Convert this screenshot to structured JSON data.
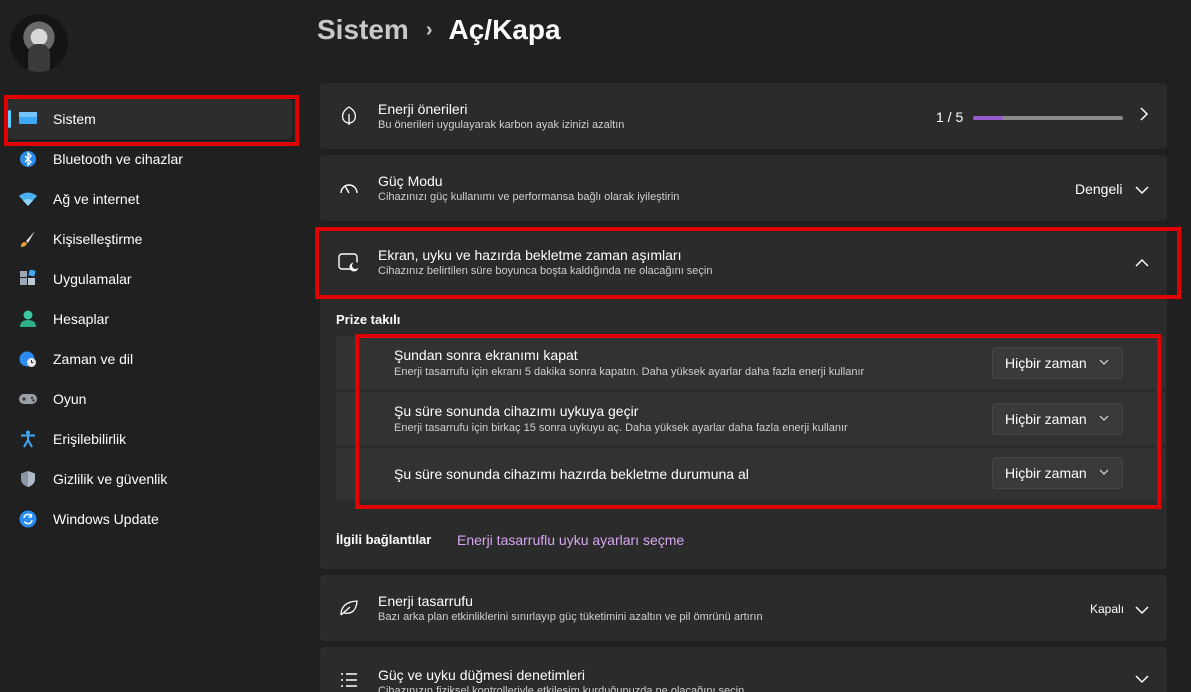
{
  "header": {
    "parent": "Sistem",
    "separator": "›",
    "current": "Aç/Kapa"
  },
  "sidebar": {
    "items": [
      {
        "label": "Sistem",
        "icon": "monitor-icon",
        "active": true
      },
      {
        "label": "Bluetooth ve cihazlar",
        "icon": "bluetooth-icon"
      },
      {
        "label": "Ağ ve internet",
        "icon": "wifi-icon"
      },
      {
        "label": "Kişiselleştirme",
        "icon": "brush-icon"
      },
      {
        "label": "Uygulamalar",
        "icon": "apps-icon"
      },
      {
        "label": "Hesaplar",
        "icon": "person-icon"
      },
      {
        "label": "Zaman ve dil",
        "icon": "globe-clock-icon"
      },
      {
        "label": "Oyun",
        "icon": "gamepad-icon"
      },
      {
        "label": "Erişilebilirlik",
        "icon": "accessibility-icon"
      },
      {
        "label": "Gizlilik ve güvenlik",
        "icon": "shield-icon"
      },
      {
        "label": "Windows Update",
        "icon": "update-icon"
      }
    ]
  },
  "energy_recommendations": {
    "title": "Enerji önerileri",
    "subtitle": "Bu önerileri uygulayarak karbon ayak izinizi azaltın",
    "progress_label": "1 / 5",
    "progress_fraction": 0.2
  },
  "power_mode": {
    "title": "Güç Modu",
    "subtitle": "Cihazınızı güç kullanımı ve performansa bağlı olarak iyileştirin",
    "value": "Dengeli"
  },
  "timeouts": {
    "title": "Ekran, uyku ve hazırda bekletme zaman aşımları",
    "subtitle": "Cihazınız belirtilen süre boyunca boşta kaldığında ne olacağını seçin",
    "section_label": "Prize takılı",
    "rows": [
      {
        "title": "Şundan sonra ekranımı kapat",
        "desc": "Enerji tasarrufu için ekranı 5 dakika sonra kapatın. Daha yüksek ayarlar daha fazla enerji kullanır",
        "value": "Hiçbir zaman"
      },
      {
        "title": "Şu süre sonunda cihazımı uykuya geçir",
        "desc": "Enerji tasarrufu için birkaç 15 sonra uykuyu aç. Daha yüksek ayarlar daha fazla enerji kullanır",
        "value": "Hiçbir zaman"
      },
      {
        "title": "Şu süre sonunda cihazımı hazırda bekletme durumuna al",
        "desc": "",
        "value": "Hiçbir zaman"
      }
    ]
  },
  "related": {
    "label": "İlgili bağlantılar",
    "link": "Enerji tasarruflu uyku ayarları seçme"
  },
  "energy_saver": {
    "title": "Enerji tasarrufu",
    "subtitle": "Bazı arka plan etkinliklerini sınırlayıp güç tüketimini azaltın ve pil ömrünü artırın",
    "value": "Kapalı"
  },
  "power_buttons": {
    "title": "Güç ve uyku düğmesi denetimleri",
    "subtitle": "Cihazınızın fiziksel kontrolleriyle etkileşim kurduğunuzda ne olacağını seçin"
  },
  "colors": {
    "accent": "#60cdff",
    "highlight": "#e00000",
    "progress": "#9b59d0",
    "link": "#d6a6f0"
  }
}
